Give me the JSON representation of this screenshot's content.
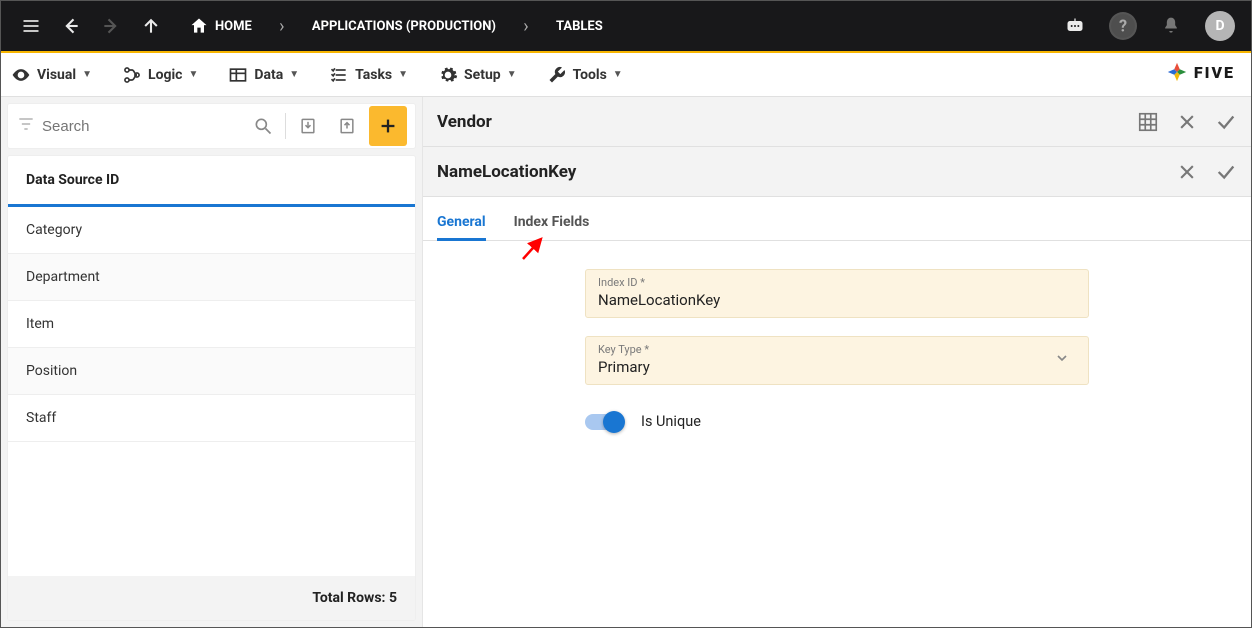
{
  "topbar": {
    "breadcrumb": [
      {
        "label": "HOME",
        "icon": "home"
      },
      {
        "label": "APPLICATIONS (PRODUCTION)"
      },
      {
        "label": "TABLES"
      }
    ],
    "avatar_initial": "D"
  },
  "menubar": {
    "items": [
      {
        "label": "Visual",
        "icon": "eye"
      },
      {
        "label": "Logic",
        "icon": "branch"
      },
      {
        "label": "Data",
        "icon": "table"
      },
      {
        "label": "Tasks",
        "icon": "list"
      },
      {
        "label": "Setup",
        "icon": "gear"
      },
      {
        "label": "Tools",
        "icon": "wrench"
      }
    ],
    "brand": "FIVE"
  },
  "left_panel": {
    "search_placeholder": "Search",
    "list_header": "Data Source ID",
    "rows": [
      "Category",
      "Department",
      "Item",
      "Position",
      "Staff"
    ],
    "footer_label": "Total Rows:",
    "footer_count": "5"
  },
  "right_panel": {
    "header1_title": "Vendor",
    "header2_title": "NameLocationKey",
    "tabs": [
      {
        "label": "General",
        "active": true
      },
      {
        "label": "Index Fields",
        "active": false
      }
    ],
    "fields": {
      "index_id": {
        "label": "Index ID *",
        "value": "NameLocationKey"
      },
      "key_type": {
        "label": "Key Type *",
        "value": "Primary"
      },
      "is_unique": {
        "label": "Is Unique",
        "value": true
      }
    }
  }
}
